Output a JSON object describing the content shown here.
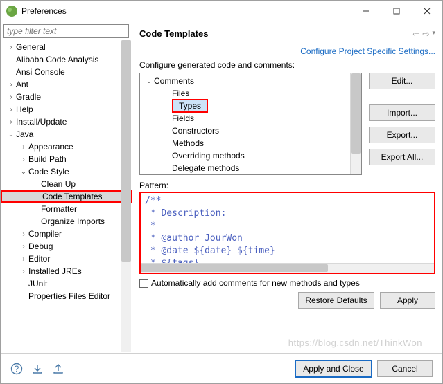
{
  "window": {
    "title": "Preferences"
  },
  "filter": {
    "placeholder": "type filter text"
  },
  "tree": [
    {
      "label": "General",
      "depth": 1,
      "exp": ">"
    },
    {
      "label": "Alibaba Code Analysis",
      "depth": 1,
      "exp": ""
    },
    {
      "label": "Ansi Console",
      "depth": 1,
      "exp": ""
    },
    {
      "label": "Ant",
      "depth": 1,
      "exp": ">"
    },
    {
      "label": "Gradle",
      "depth": 1,
      "exp": ">"
    },
    {
      "label": "Help",
      "depth": 1,
      "exp": ">"
    },
    {
      "label": "Install/Update",
      "depth": 1,
      "exp": ">"
    },
    {
      "label": "Java",
      "depth": 1,
      "exp": "v"
    },
    {
      "label": "Appearance",
      "depth": 2,
      "exp": ">"
    },
    {
      "label": "Build Path",
      "depth": 2,
      "exp": ">"
    },
    {
      "label": "Code Style",
      "depth": 2,
      "exp": "v"
    },
    {
      "label": "Clean Up",
      "depth": 3,
      "exp": ""
    },
    {
      "label": "Code Templates",
      "depth": 3,
      "exp": "",
      "sel": true,
      "hl": true
    },
    {
      "label": "Formatter",
      "depth": 3,
      "exp": ""
    },
    {
      "label": "Organize Imports",
      "depth": 3,
      "exp": ""
    },
    {
      "label": "Compiler",
      "depth": 2,
      "exp": ">"
    },
    {
      "label": "Debug",
      "depth": 2,
      "exp": ">"
    },
    {
      "label": "Editor",
      "depth": 2,
      "exp": ">"
    },
    {
      "label": "Installed JREs",
      "depth": 2,
      "exp": ">"
    },
    {
      "label": "JUnit",
      "depth": 2,
      "exp": ""
    },
    {
      "label": "Properties Files Editor",
      "depth": 2,
      "exp": ""
    }
  ],
  "right": {
    "title": "Code Templates",
    "link": "Configure Project Specific Settings...",
    "genLabel": "Configure generated code and comments:",
    "genTree": [
      {
        "label": "Comments",
        "depth": 1,
        "exp": "v"
      },
      {
        "label": "Files",
        "depth": 2
      },
      {
        "label": "Types",
        "depth": 2,
        "sel": true,
        "hl": true
      },
      {
        "label": "Fields",
        "depth": 2
      },
      {
        "label": "Constructors",
        "depth": 2
      },
      {
        "label": "Methods",
        "depth": 2
      },
      {
        "label": "Overriding methods",
        "depth": 2
      },
      {
        "label": "Delegate methods",
        "depth": 2
      }
    ],
    "sideButtons": {
      "edit": "Edit...",
      "import": "Import...",
      "export": "Export...",
      "exportAll": "Export All..."
    },
    "patternLabel": "Pattern:",
    "pattern": "/**\n * Description: \n *\n * @author JourWon\n * @date ${date} ${time}\n * ${tags}",
    "autoAdd": "Automatically add comments for new methods and types",
    "restore": "Restore Defaults",
    "apply": "Apply"
  },
  "footer": {
    "applyClose": "Apply and Close",
    "cancel": "Cancel"
  },
  "watermark": "https://blog.csdn.net/ThinkWon"
}
